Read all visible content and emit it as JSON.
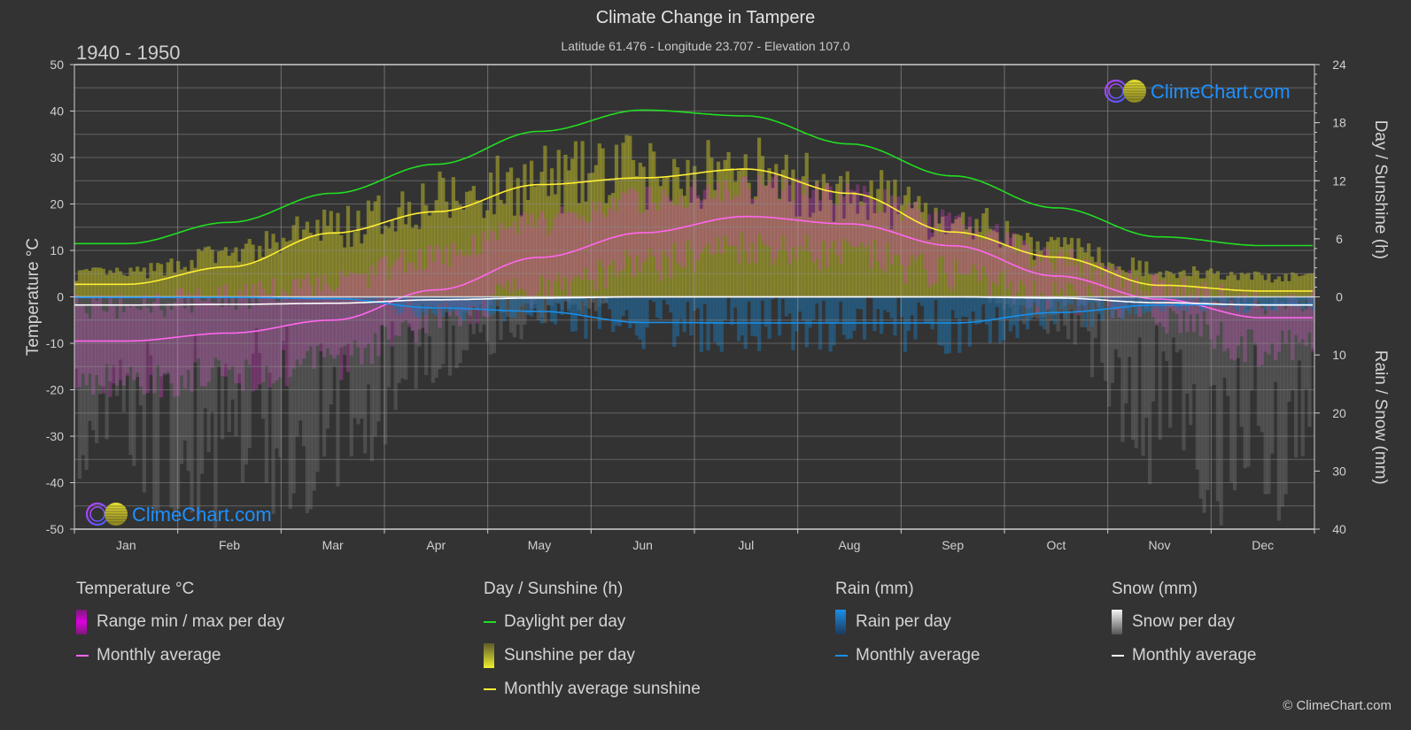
{
  "header": {
    "title": "Climate Change in Tampere",
    "subtitle": "Latitude 61.476 - Longitude 23.707 - Elevation 107.0",
    "period": "1940 - 1950"
  },
  "watermark": "ClimeChart.com",
  "copyright": "© ClimeChart.com",
  "colors": {
    "background": "#333333",
    "temp_range": "#e000e0",
    "temp_avg": "#ff66ee",
    "daylight": "#22dd22",
    "sunshine": "#dddd22",
    "sunshine_avg": "#ffee33",
    "rain": "#1a8fe8",
    "rain_avg": "#1a8fe8",
    "snow": "#dddddd",
    "snow_avg": "#ffffff",
    "brand": "#1e90ff"
  },
  "chart_data": {
    "type": "line",
    "title": "Climate Change in Tampere",
    "subtitle": "Latitude 61.476 - Longitude 23.707 - Elevation 107.0",
    "categories": [
      "Jan",
      "Feb",
      "Mar",
      "Apr",
      "May",
      "Jun",
      "Jul",
      "Aug",
      "Sep",
      "Oct",
      "Nov",
      "Dec"
    ],
    "axes": {
      "left": {
        "label": "Temperature °C",
        "range": [
          -50,
          50
        ],
        "ticks": [
          50,
          40,
          30,
          20,
          10,
          0,
          -10,
          -20,
          -30,
          -40,
          -50
        ]
      },
      "right_top": {
        "label": "Day / Sunshine (h)",
        "range": [
          0,
          24
        ],
        "ticks": [
          24,
          18,
          12,
          6,
          0
        ]
      },
      "right_bottom": {
        "label": "Rain / Snow (mm)",
        "range": [
          0,
          40
        ],
        "ticks": [
          0,
          10,
          20,
          30,
          40
        ],
        "inverted": true
      }
    },
    "grid": true,
    "series": [
      {
        "name": "Temperature monthly average",
        "unit": "°C",
        "axis": "left",
        "values": [
          -9.5,
          -7.8,
          -5.0,
          1.5,
          8.5,
          13.8,
          17.3,
          15.7,
          11.0,
          4.5,
          -0.5,
          -4.5
        ]
      },
      {
        "name": "Temperature daily max (approx. envelope)",
        "unit": "°C",
        "axis": "left",
        "values": [
          -2,
          0,
          3,
          9,
          16,
          21,
          24,
          22,
          16,
          8,
          2,
          -1
        ]
      },
      {
        "name": "Temperature daily min (approx. envelope)",
        "unit": "°C",
        "axis": "left",
        "values": [
          -18,
          -17,
          -14,
          -5,
          1,
          7,
          11,
          9,
          5,
          0,
          -4,
          -11
        ]
      },
      {
        "name": "Daylight per day",
        "unit": "h",
        "axis": "right_top",
        "values": [
          5.5,
          7.7,
          10.7,
          13.7,
          17.1,
          19.3,
          18.7,
          15.8,
          12.5,
          9.2,
          6.2,
          5.3
        ]
      },
      {
        "name": "Monthly average sunshine",
        "unit": "h",
        "axis": "right_top",
        "values": [
          1.3,
          3.1,
          6.6,
          8.8,
          11.6,
          12.3,
          13.2,
          10.7,
          6.7,
          4.1,
          1.2,
          0.6
        ]
      },
      {
        "name": "Sunshine per day (approx. envelope)",
        "unit": "h",
        "axis": "right_top",
        "values": [
          3.0,
          5.5,
          9.0,
          12.5,
          15.0,
          16.2,
          16.0,
          13.5,
          10.0,
          6.5,
          3.5,
          2.5
        ]
      },
      {
        "name": "Rain monthly average",
        "unit": "mm",
        "axis": "right_bottom",
        "values": [
          0.1,
          0.1,
          0.3,
          1.9,
          2.5,
          4.4,
          4.5,
          4.5,
          4.5,
          2.7,
          1.4,
          1.3
        ]
      },
      {
        "name": "Snow monthly average",
        "unit": "mm",
        "axis": "right_bottom",
        "values": [
          1.4,
          1.3,
          1.1,
          0.5,
          0.2,
          0.0,
          0.0,
          0.0,
          0.0,
          0.2,
          1.0,
          1.4
        ]
      }
    ]
  },
  "legend": {
    "groups": [
      {
        "title": "Temperature °C",
        "items": [
          {
            "label": "Range min / max per day",
            "kind": "bar",
            "color": "#e000e0"
          },
          {
            "label": "Monthly average",
            "kind": "line",
            "color": "#ff66ee"
          }
        ]
      },
      {
        "title": "Day / Sunshine (h)",
        "items": [
          {
            "label": "Daylight per day",
            "kind": "line",
            "color": "#22dd22"
          },
          {
            "label": "Sunshine per day",
            "kind": "bar",
            "color": "#dddd22"
          },
          {
            "label": "Monthly average sunshine",
            "kind": "line",
            "color": "#ffee33"
          }
        ]
      },
      {
        "title": "Rain (mm)",
        "items": [
          {
            "label": "Rain per day",
            "kind": "bar",
            "color": "#1a8fe8"
          },
          {
            "label": "Monthly average",
            "kind": "line",
            "color": "#1a8fe8"
          }
        ]
      },
      {
        "title": "Snow (mm)",
        "items": [
          {
            "label": "Snow per day",
            "kind": "bar",
            "color": "#dddddd"
          },
          {
            "label": "Monthly average",
            "kind": "line",
            "color": "#ffffff"
          }
        ]
      }
    ]
  }
}
